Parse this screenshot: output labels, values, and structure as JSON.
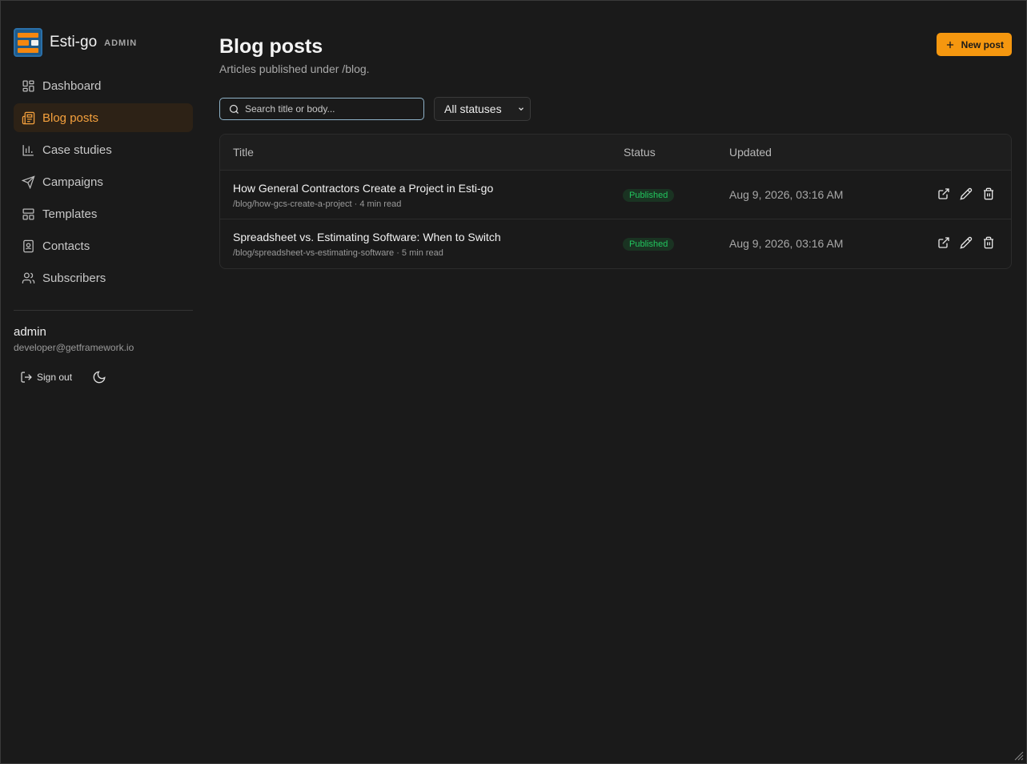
{
  "brand": {
    "name": "Esti-go",
    "tag": "ADMIN"
  },
  "nav": [
    {
      "label": "Dashboard",
      "icon": "dashboard-icon",
      "active": false
    },
    {
      "label": "Blog posts",
      "icon": "newspaper-icon",
      "active": true
    },
    {
      "label": "Case studies",
      "icon": "bar-chart-icon",
      "active": false
    },
    {
      "label": "Campaigns",
      "icon": "send-icon",
      "active": false
    },
    {
      "label": "Templates",
      "icon": "layout-icon",
      "active": false
    },
    {
      "label": "Contacts",
      "icon": "contact-book-icon",
      "active": false
    },
    {
      "label": "Subscribers",
      "icon": "users-icon",
      "active": false
    }
  ],
  "user": {
    "name": "admin",
    "email": "developer@getframework.io",
    "signout_label": "Sign out"
  },
  "page": {
    "title": "Blog posts",
    "subtitle": "Articles published under /blog."
  },
  "new_button": {
    "label": "New post"
  },
  "search": {
    "placeholder": "Search title or body...",
    "value": ""
  },
  "filter": {
    "selected": "All statuses"
  },
  "table": {
    "headers": {
      "title": "Title",
      "status": "Status",
      "updated": "Updated"
    },
    "rows": [
      {
        "title": "How General Contractors Create a Project in Esti-go",
        "meta": "/blog/how-gcs-create-a-project · 4 min read",
        "status": "Published",
        "updated": "Aug 9, 2026, 03:16 AM"
      },
      {
        "title": "Spreadsheet vs. Estimating Software: When to Switch",
        "meta": "/blog/spreadsheet-vs-estimating-software · 5 min read",
        "status": "Published",
        "updated": "Aug 9, 2026, 03:16 AM"
      }
    ]
  },
  "colors": {
    "accent": "#f5970f",
    "active_nav_bg": "#2d2216",
    "published": "#22c55e",
    "background": "#1a1a1a"
  }
}
